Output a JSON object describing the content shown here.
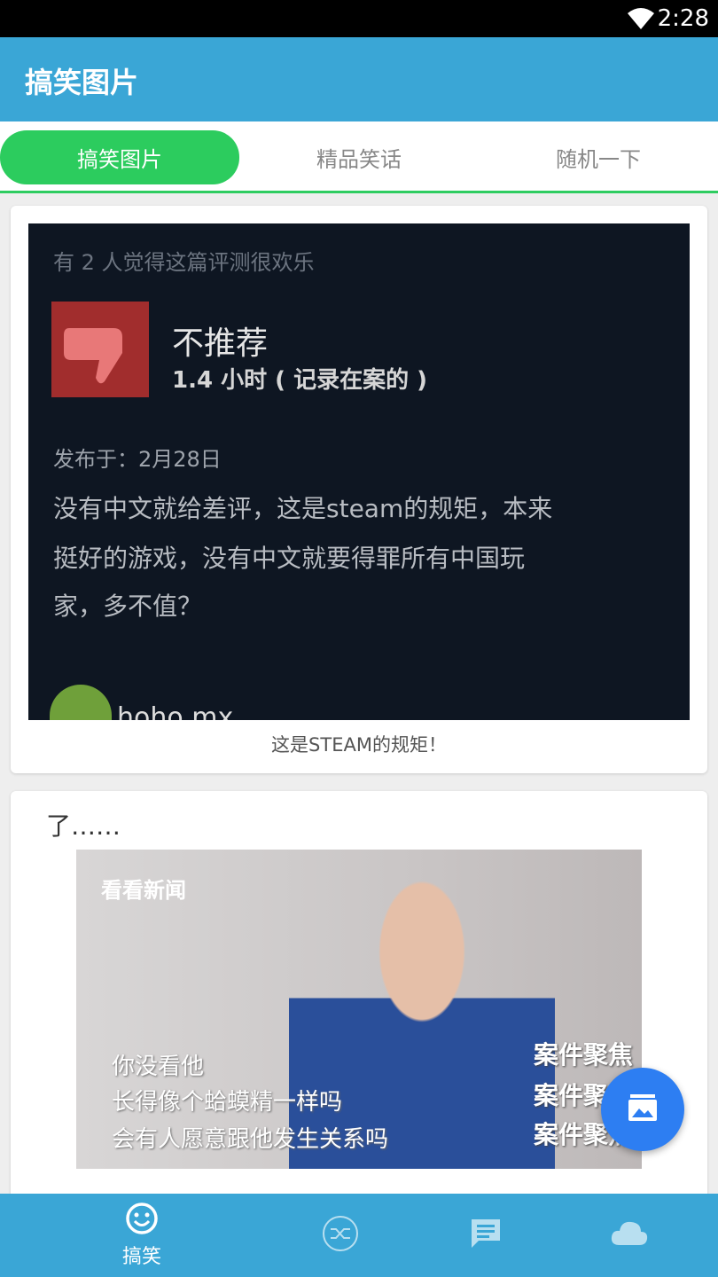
{
  "status_bar": {
    "time": "2:28",
    "wifi_icon": "wifi-icon"
  },
  "app_bar": {
    "title": "搞笑图片"
  },
  "tabs": [
    {
      "label": "搞笑图片",
      "active": true
    },
    {
      "label": "精品笑话",
      "active": false
    },
    {
      "label": "随机一下",
      "active": false
    }
  ],
  "feed": {
    "card1": {
      "image": {
        "line_top": "有 2 人觉得这篇评测很欢乐",
        "verdict": "不推荐",
        "hours": "1.4 小时 ( 记录在案的 )",
        "posted": "发布于：2月28日",
        "body_lines": [
          "没有中文就给差评，这是steam的规矩，本来",
          "挺好的游戏，没有中文就要得罪所有中国玩",
          "家，多不值？"
        ],
        "user": "hoho mx"
      },
      "caption": "这是STEAM的规矩！"
    },
    "card2": {
      "top_text": "了……",
      "image": {
        "logo": "看看新闻",
        "subtitles": [
          "你没看他",
          "长得像个蛤蟆精一样吗",
          "会有人愿意跟他发生关系吗"
        ],
        "stamp": "案件聚焦"
      }
    }
  },
  "fab": {
    "icon": "image-gallery-icon"
  },
  "bottom_nav": [
    {
      "icon": "smiley-icon",
      "label": "搞笑",
      "active": true
    },
    {
      "icon": "shuffle-icon",
      "label": "",
      "active": false
    },
    {
      "icon": "message-icon",
      "label": "",
      "active": false
    },
    {
      "icon": "cloud-icon",
      "label": "",
      "active": false
    }
  ],
  "colors": {
    "primary": "#3aa6d6",
    "accent_green": "#2ccc5e",
    "fab_blue": "#2d7ef2"
  }
}
